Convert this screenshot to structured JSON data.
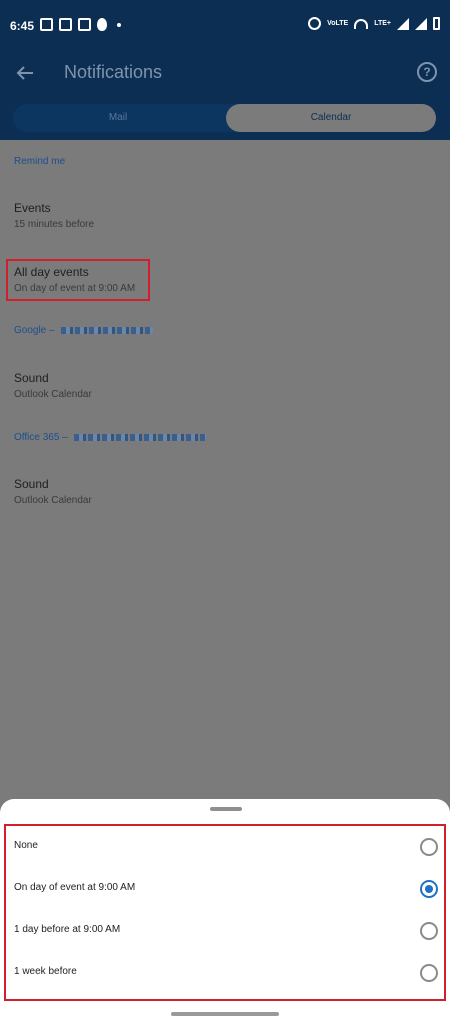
{
  "status_bar": {
    "time": "6:45",
    "volte": "VoLTE",
    "lte": "LTE+"
  },
  "app_bar": {
    "title": "Notifications",
    "help_glyph": "?"
  },
  "tabs": [
    {
      "label": "Mail",
      "selected": false
    },
    {
      "label": "Calendar",
      "selected": true
    }
  ],
  "sections": {
    "remind_me": "Remind me",
    "google": "Google –",
    "office365": "Office 365 –"
  },
  "items": {
    "events": {
      "title": "Events",
      "subtitle": "15 minutes before"
    },
    "all_day": {
      "title": "All day events",
      "subtitle": "On day of event at 9:00 AM"
    },
    "google_sound": {
      "title": "Sound",
      "subtitle": "Outlook Calendar"
    },
    "office_sound": {
      "title": "Sound",
      "subtitle": "Outlook Calendar"
    }
  },
  "sheet": {
    "options": [
      {
        "label": "None",
        "selected": false
      },
      {
        "label": "On day of event at 9:00 AM",
        "selected": true
      },
      {
        "label": "1 day before at 9:00 AM",
        "selected": false
      },
      {
        "label": "1 week before",
        "selected": false
      }
    ]
  },
  "colors": {
    "accent": "#1e72c6",
    "highlight": "#d21f2e",
    "appbar": "#0b2e52"
  }
}
